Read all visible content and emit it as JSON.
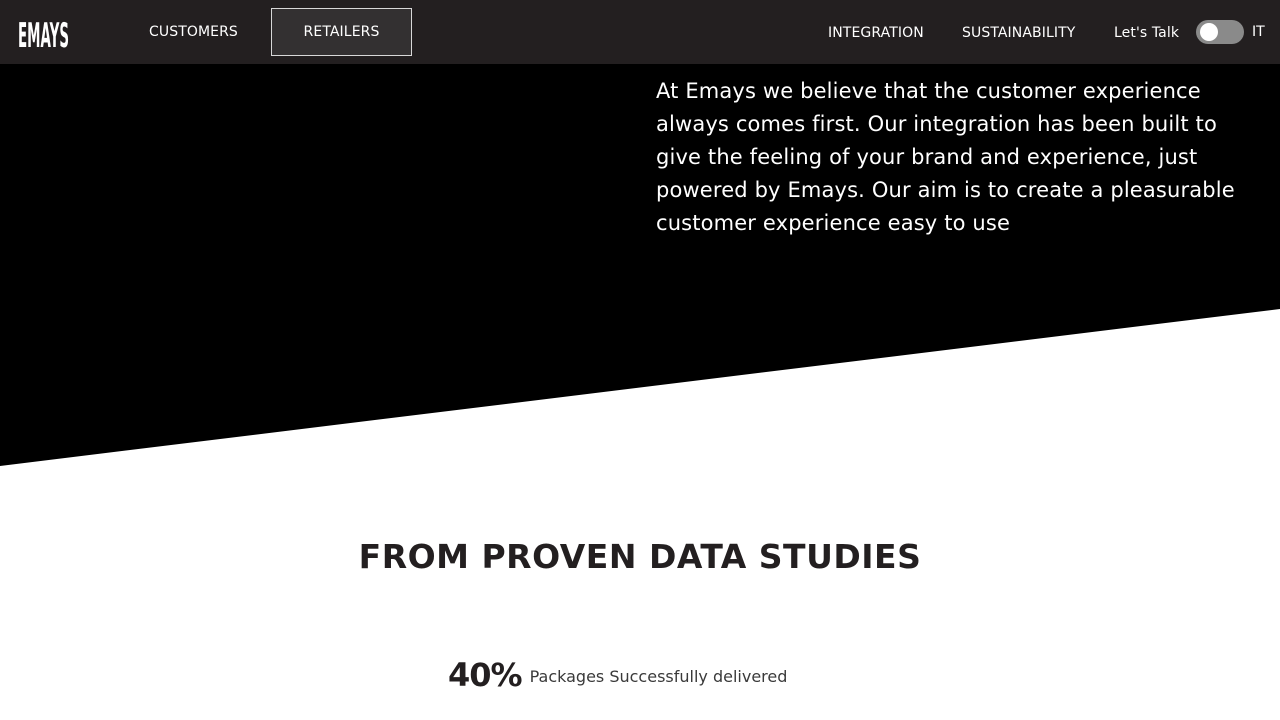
{
  "brand": {
    "logo_text": "EMAYS"
  },
  "nav": {
    "left_items": [
      "CUSTOMERS",
      "RETAILERS"
    ],
    "active_item": "RETAILERS",
    "right_items": [
      "INTEGRATION",
      "SUSTAINABILITY",
      "Let's Talk"
    ],
    "language_toggle_label": "IT"
  },
  "hero": {
    "text": "At Emays we believe that the customer experience always comes first. Our integration has been built to give the feeling of your brand and experience, just powered by Emays. Our aim is to create a pleasurable customer experience easy to use"
  },
  "stats": {
    "title": "FROM PROVEN DATA STUDIES",
    "items": [
      {
        "value": "40%",
        "label": "Packages Successfully delivered"
      }
    ]
  },
  "colors": {
    "nav_background": "#231f20",
    "hero_background": "#000000",
    "page_background": "#ffffff",
    "text_dark": "#231f20"
  }
}
